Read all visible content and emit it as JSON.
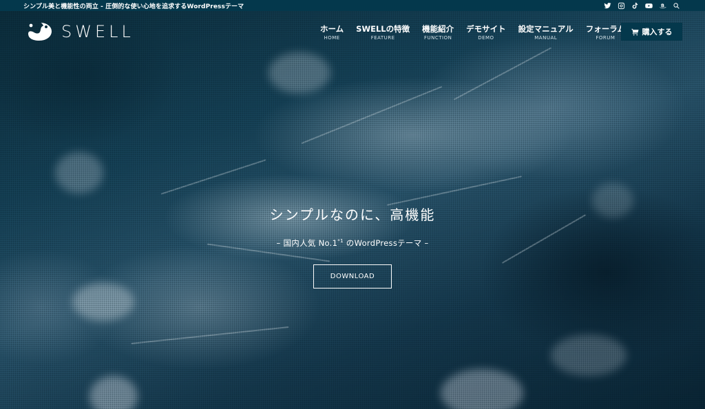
{
  "topbar": {
    "tagline": "シンプル美と機能性の両立 - 圧倒的な使い心地を追求するWordPressテーマ",
    "social_icons": [
      "twitter-icon",
      "instagram-icon",
      "tiktok-icon",
      "youtube-icon",
      "amazon-icon",
      "search-icon"
    ]
  },
  "header": {
    "logo_text": "SWELL",
    "nav": [
      {
        "label": "ホーム",
        "sub": "HOME"
      },
      {
        "label": "SWELLの特徴",
        "sub": "FEATURE"
      },
      {
        "label": "機能紹介",
        "sub": "FUNCTION"
      },
      {
        "label": "デモサイト",
        "sub": "DEMO"
      },
      {
        "label": "設定マニュアル",
        "sub": "MANUAL"
      },
      {
        "label": "フォーラム",
        "sub": "FORUM"
      }
    ],
    "buy_button": {
      "label": "購入する",
      "icon": "cart-icon"
    }
  },
  "hero": {
    "catch": "シンプルなのに、高機能",
    "sub_prefix": "– 国内人気 No.1",
    "sub_sup": "*1",
    "sub_suffix": " のWordPressテーマ –",
    "button": "DOWNLOAD"
  },
  "colors": {
    "topbar_bg": "#04384c",
    "buy_button_bg": "#04384c",
    "text": "#ffffff"
  }
}
